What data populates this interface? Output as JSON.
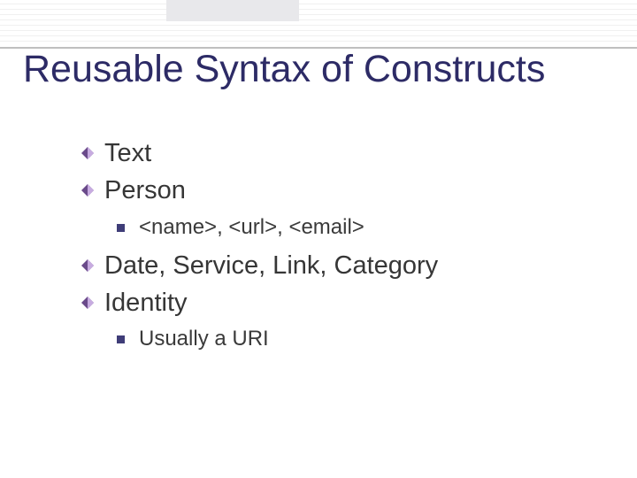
{
  "slide": {
    "title": "Reusable Syntax of Constructs",
    "bullets": [
      {
        "level": 1,
        "text": "Text"
      },
      {
        "level": 1,
        "text": "Person"
      },
      {
        "level": 2,
        "text": "<name>, <url>, <email>"
      },
      {
        "level": 1,
        "text": "Date, Service, Link, Category"
      },
      {
        "level": 1,
        "text": "Identity"
      },
      {
        "level": 2,
        "text": "Usually a URI"
      }
    ]
  }
}
